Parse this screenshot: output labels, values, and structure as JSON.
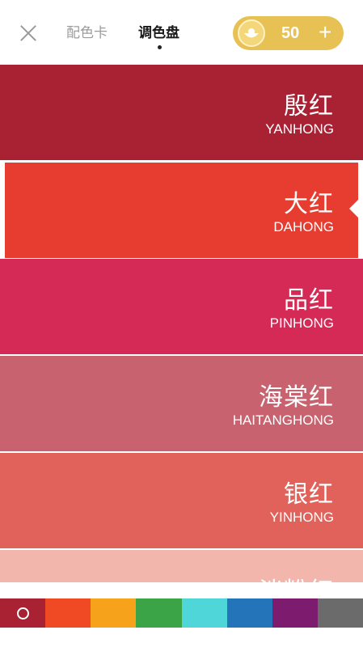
{
  "header": {
    "tabs": [
      {
        "label": "配色卡"
      },
      {
        "label": "调色盘"
      }
    ],
    "coins": {
      "count": "50",
      "plus": "+"
    }
  },
  "colors": [
    {
      "cn": "殷红",
      "en": "YANHONG",
      "hex": "#a92234"
    },
    {
      "cn": "大红",
      "en": "DAHONG",
      "hex": "#e63d30"
    },
    {
      "cn": "品红",
      "en": "PINHONG",
      "hex": "#d52a55"
    },
    {
      "cn": "海棠红",
      "en": "HAITANGHONG",
      "hex": "#c7626e"
    },
    {
      "cn": "银红",
      "en": "YINHONG",
      "hex": "#e0625a"
    },
    {
      "cn": "淡粉红",
      "en": "",
      "hex": "#f3b6ad"
    }
  ],
  "selected_color_index": 1,
  "palette_families": [
    {
      "name": "red",
      "hex": "#a92234"
    },
    {
      "name": "orange-red",
      "hex": "#f04a24"
    },
    {
      "name": "orange",
      "hex": "#f7a21b"
    },
    {
      "name": "green",
      "hex": "#3aa447"
    },
    {
      "name": "cyan",
      "hex": "#4fd6d8"
    },
    {
      "name": "blue",
      "hex": "#2374b8"
    },
    {
      "name": "purple",
      "hex": "#7d1b6f"
    },
    {
      "name": "gray",
      "hex": "#6b6b6b"
    }
  ],
  "selected_family_index": 0
}
